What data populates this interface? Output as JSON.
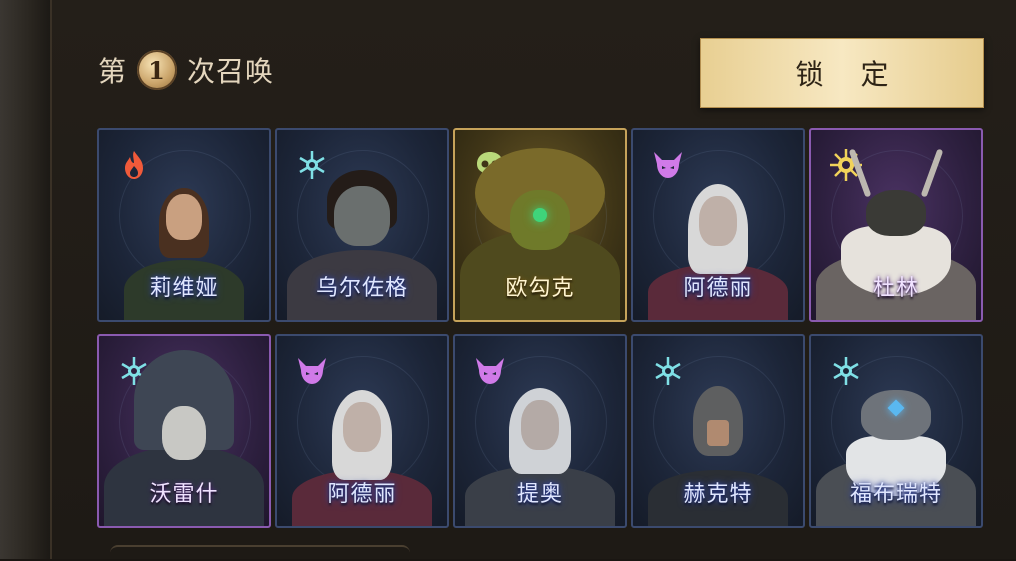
{
  "header": {
    "prefix": "第",
    "number": "1",
    "suffix": "次召唤"
  },
  "lock_button": {
    "label": "锁 定"
  },
  "heroes": [
    {
      "name": "莉维娅",
      "faction_icon": "flame-icon",
      "icon_color": "#f05a3a",
      "frame": "blue"
    },
    {
      "name": "乌尔佐格",
      "faction_icon": "frost-snowflake-icon",
      "icon_color": "#7fe0e6",
      "frame": "blue"
    },
    {
      "name": "欧勾克",
      "faction_icon": "skull-icon",
      "icon_color": "#b9d97a",
      "frame": "gold"
    },
    {
      "name": "阿德丽",
      "faction_icon": "demon-horned-icon",
      "icon_color": "#d07ae8",
      "frame": "blue"
    },
    {
      "name": "杜林",
      "faction_icon": "sun-star-icon",
      "icon_color": "#f1d35a",
      "frame": "purple"
    },
    {
      "name": "沃雷什",
      "faction_icon": "frost-snowflake-icon",
      "icon_color": "#7fe0e6",
      "frame": "purple"
    },
    {
      "name": "阿德丽",
      "faction_icon": "demon-horned-icon",
      "icon_color": "#d07ae8",
      "frame": "blue"
    },
    {
      "name": "提奥",
      "faction_icon": "demon-horned-icon",
      "icon_color": "#d07ae8",
      "frame": "blue"
    },
    {
      "name": "赫克特",
      "faction_icon": "frost-snowflake-icon",
      "icon_color": "#7fe0e6",
      "frame": "blue"
    },
    {
      "name": "福布瑞特",
      "faction_icon": "frost-snowflake-icon",
      "icon_color": "#7fe0e6",
      "frame": "blue"
    }
  ]
}
